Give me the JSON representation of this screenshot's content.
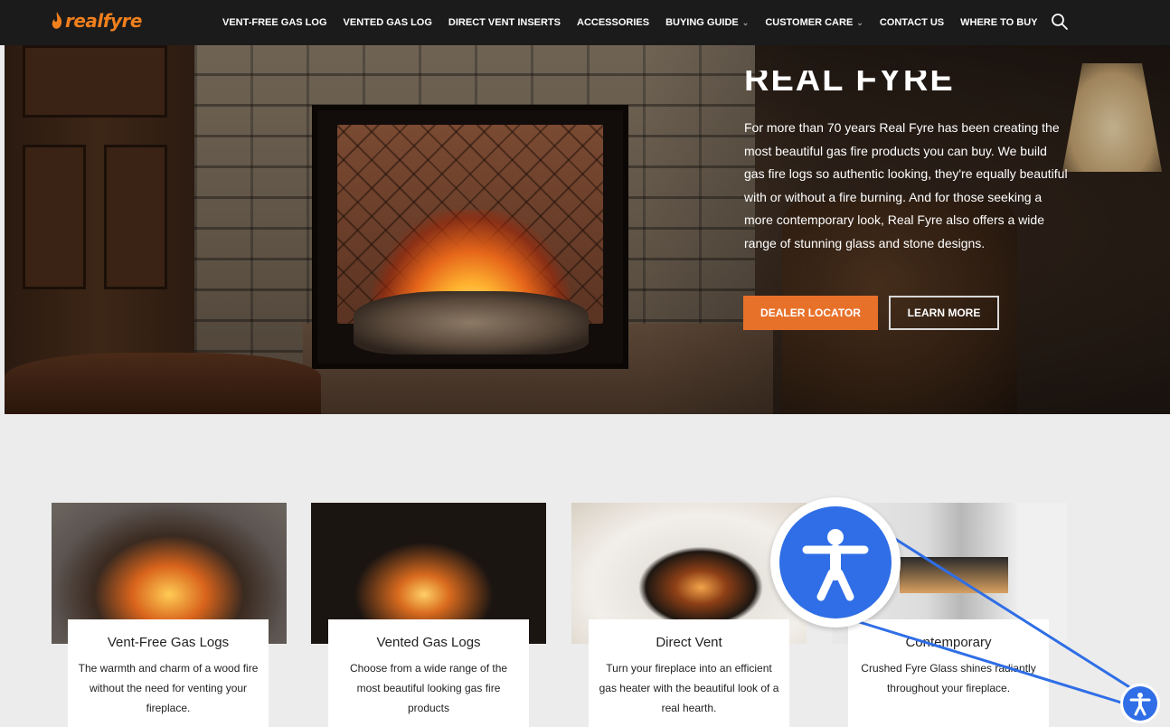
{
  "header": {
    "logo_text": "realfyre",
    "menu": [
      {
        "label": "VENT-FREE GAS LOG",
        "has_dropdown": false
      },
      {
        "label": "VENTED GAS LOG",
        "has_dropdown": false
      },
      {
        "label": "DIRECT VENT INSERTS",
        "has_dropdown": false
      },
      {
        "label": "ACCESSORIES",
        "has_dropdown": false
      },
      {
        "label": "BUYING GUIDE",
        "has_dropdown": true
      },
      {
        "label": "CUSTOMER CARE",
        "has_dropdown": true
      },
      {
        "label": "CONTACT US",
        "has_dropdown": false
      },
      {
        "label": "WHERE TO BUY",
        "has_dropdown": false
      }
    ],
    "search_icon": "search-icon"
  },
  "hero": {
    "title": "REAL FYRE",
    "body": "For more than 70 years Real Fyre has been creating the most beautiful gas fire products you can buy. We build gas fire logs so authentic looking, they're equally beautiful with or without a fire burning. And for those seeking a more contemporary look, Real Fyre also offers a wide range of stunning glass and stone designs.",
    "dealer_button": "DEALER LOCATOR",
    "learn_button": "LEARN MORE"
  },
  "cards": [
    {
      "title": "Vent-Free Gas Logs",
      "desc": "The warmth and charm of a wood fire without the need for venting your fireplace."
    },
    {
      "title": "Vented Gas Logs",
      "desc": "Choose from a wide range of the most beautiful looking gas fire products"
    },
    {
      "title": "Direct Vent",
      "desc": "Turn your fireplace into an efficient gas heater with the beautiful look of a real hearth."
    },
    {
      "title": "Contemporary",
      "desc": "Crushed Fyre Glass shines radiantly throughout your fireplace."
    }
  ],
  "colors": {
    "nav_bg": "#1b1b1b",
    "accent_orange": "#e8712a",
    "a11y_blue": "#2f6ee6",
    "page_bg": "#ececec"
  },
  "accessibility_icon": "accessibility-person-icon"
}
